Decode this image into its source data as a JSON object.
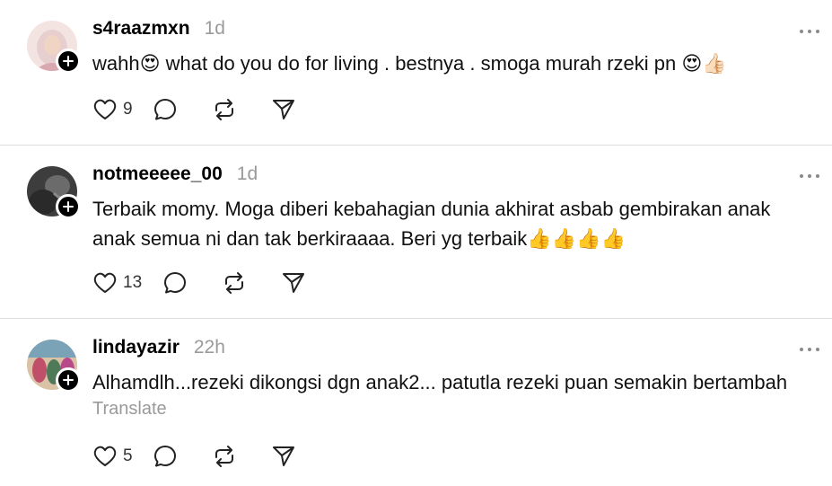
{
  "comments": [
    {
      "username": "s4raazmxn",
      "time": "1d",
      "text": "wahh😍 what do you do for living . bestnya . smoga murah rzeki pn 😍👍🏻",
      "likes": "9",
      "avatar_color": "#e8c8c8"
    },
    {
      "username": "notmeeeee_00",
      "time": "1d",
      "text": "Terbaik momy. Moga diberi kebahagian dunia akhirat asbab gembirakan anak anak semua ni dan tak berkiraaaa. Beri yg terbaik👍👍👍👍",
      "likes": "13",
      "avatar_color": "#4a4a4a"
    },
    {
      "username": "lindayazir",
      "time": "22h",
      "text": "Alhamdlh...rezeki dikongsi dgn anak2... patutla rezeki puan semakin bertambah",
      "translate": "Translate",
      "likes": "5",
      "avatar_color": "#b85c6e"
    }
  ]
}
